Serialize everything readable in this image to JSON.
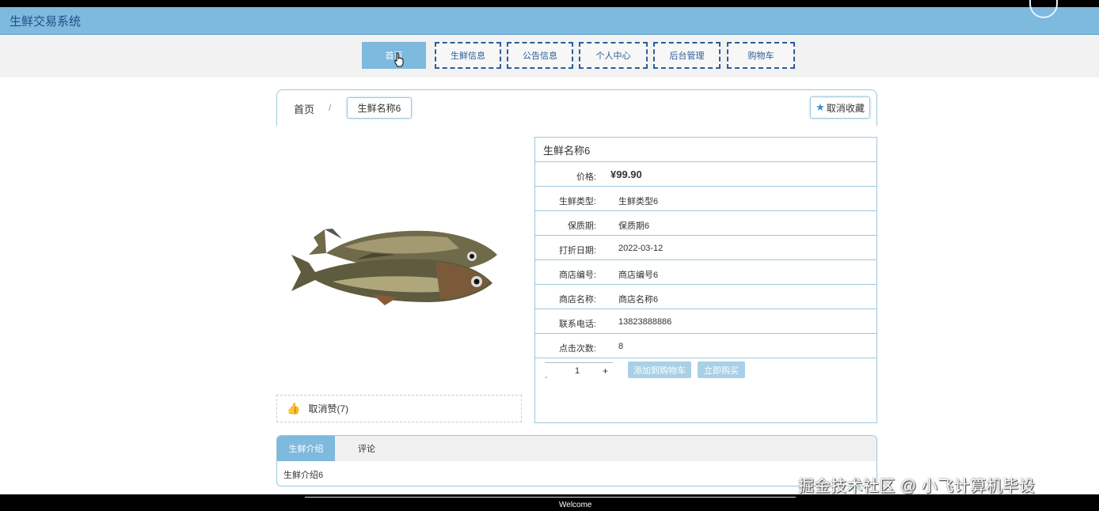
{
  "header": {
    "title": "生鲜交易系统"
  },
  "nav": {
    "items": [
      {
        "label": "首页"
      },
      {
        "label": "生鲜信息"
      },
      {
        "label": "公告信息"
      },
      {
        "label": "个人中心"
      },
      {
        "label": "后台管理"
      },
      {
        "label": "购物车"
      }
    ]
  },
  "breadcrumb": {
    "home": "首页",
    "separator": "/",
    "current": "生鲜名称6"
  },
  "favorite": {
    "label": "取消收藏"
  },
  "like": {
    "label": "取消赞(7)"
  },
  "product": {
    "title": "生鲜名称6",
    "rows": [
      {
        "label": "价格:",
        "value": "¥99.90"
      },
      {
        "label": "生鲜类型:",
        "value": "生鲜类型6"
      },
      {
        "label": "保质期:",
        "value": "保质期6"
      },
      {
        "label": "打折日期:",
        "value": "2022-03-12"
      },
      {
        "label": "商店编号:",
        "value": "商店编号6"
      },
      {
        "label": "商店名称:",
        "value": "商店名称6"
      },
      {
        "label": "联系电话:",
        "value": "13823888886"
      },
      {
        "label": "点击次数:",
        "value": "8"
      }
    ],
    "quantity": "1",
    "minus": "-",
    "plus": "+",
    "add_to_cart": "添加到购物车",
    "buy_now": "立即购买"
  },
  "tabs": {
    "items": [
      {
        "label": "生鲜介绍"
      },
      {
        "label": "评论"
      }
    ],
    "content": "生鲜介绍6"
  },
  "footer": {
    "welcome": "Welcome"
  },
  "watermark": "掘金技术社区 @ 小飞计算机毕设"
}
